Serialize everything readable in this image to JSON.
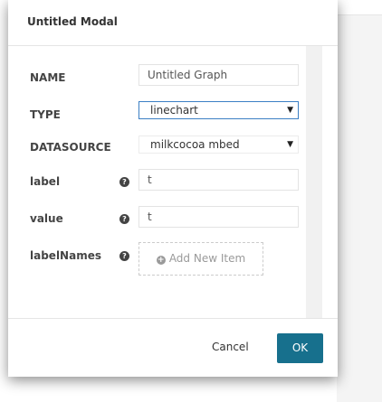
{
  "modal": {
    "title": "Untitled Modal"
  },
  "form": {
    "name": {
      "label": "NAME",
      "value": "Untitled Graph"
    },
    "type": {
      "label": "TYPE",
      "value": "linechart"
    },
    "datasource": {
      "label": "DATASOURCE",
      "value": "milkcocoa mbed"
    },
    "label_field": {
      "label": "label",
      "value": "t"
    },
    "value_field": {
      "label": "value",
      "value": "t"
    },
    "label_names": {
      "label": "labelNames",
      "add_item": "Add New Item"
    }
  },
  "icons": {
    "help": "?",
    "caret": "▼",
    "plus": "+"
  },
  "footer": {
    "cancel_label": "Cancel",
    "ok_label": "OK"
  },
  "colors": {
    "primary_button": "#17708d",
    "focus_border": "#3b7fc4"
  }
}
